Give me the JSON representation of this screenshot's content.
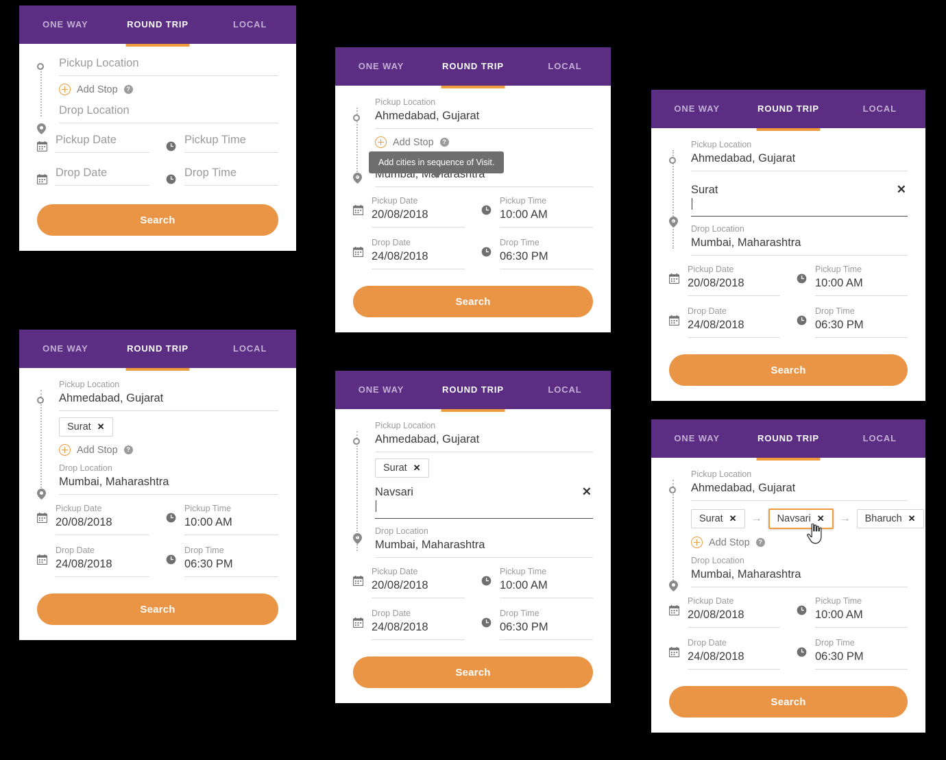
{
  "theme": {
    "purple": "#5B2E83",
    "orange": "#EA9445",
    "tooltip_gray": "#6E6E6E",
    "background": "#000000"
  },
  "tabs": {
    "one_way": "ONE WAY",
    "round_trip": "ROUND TRIP",
    "local": "LOCAL",
    "active": "ROUND TRIP"
  },
  "labels": {
    "pickup_location": "Pickup Location",
    "drop_location": "Drop Location",
    "pickup_date": "Pickup Date",
    "drop_date": "Drop Date",
    "pickup_time": "Pickup Time",
    "drop_time": "Drop Time",
    "add_stop": "Add Stop",
    "search": "Search",
    "help_glyph": "?",
    "clear_glyph": "✕",
    "chip_remove_glyph": "✕",
    "arrow_glyph": "→"
  },
  "tooltip": {
    "text": "Add cities in sequence of Visit."
  },
  "values": {
    "pickup_location": "Ahmedabad, Gujarat",
    "drop_location": "Mumbai, Maharashtra",
    "pickup_date": "20/08/2018",
    "drop_date": "24/08/2018",
    "pickup_time": "10:00 AM",
    "drop_time": "06:30 PM"
  },
  "cards": [
    {
      "id": "card1",
      "state": "empty-form",
      "pickup_value": "",
      "pickup_placeholder": "Pickup Location",
      "drop_value": "",
      "drop_placeholder": "Drop Location",
      "pickup_date": "",
      "pickup_date_placeholder": "Pickup Date",
      "drop_date": "",
      "drop_date_placeholder": "Drop Date",
      "pickup_time": "",
      "pickup_time_placeholder": "Pickup Time",
      "drop_time": "",
      "drop_time_placeholder": "Drop Time",
      "stops": [],
      "typing_value": null,
      "tooltip_visible": false,
      "cursor_visible": false
    },
    {
      "id": "card2",
      "state": "tooltip-on-add-stop",
      "pickup_value": "Ahmedabad, Gujarat",
      "drop_value": "Mumbai, Maharashtra",
      "pickup_date": "20/08/2018",
      "drop_date": "24/08/2018",
      "pickup_time": "10:00 AM",
      "drop_time": "06:30 PM",
      "stops": [],
      "typing_value": null,
      "tooltip_visible": true,
      "tooltip_text": "Add cities in sequence of Visit.",
      "cursor_visible": false
    },
    {
      "id": "card3",
      "state": "typing-first-stop",
      "pickup_value": "Ahmedabad, Gujarat",
      "drop_value": "Mumbai, Maharashtra",
      "pickup_date": "20/08/2018",
      "drop_date": "24/08/2018",
      "pickup_time": "10:00 AM",
      "drop_time": "06:30 PM",
      "stops": [],
      "typing_value": "Surat",
      "tooltip_visible": false,
      "cursor_visible": false
    },
    {
      "id": "card4",
      "state": "one-stop-chip",
      "pickup_value": "Ahmedabad, Gujarat",
      "drop_value": "Mumbai, Maharashtra",
      "pickup_date": "20/08/2018",
      "drop_date": "24/08/2018",
      "pickup_time": "10:00 AM",
      "drop_time": "06:30 PM",
      "stops": [
        {
          "label": "Surat",
          "dragging": false
        }
      ],
      "typing_value": null,
      "tooltip_visible": false,
      "cursor_visible": false
    },
    {
      "id": "card5",
      "state": "typing-second-stop",
      "pickup_value": "Ahmedabad, Gujarat",
      "drop_value": "Mumbai, Maharashtra",
      "pickup_date": "20/08/2018",
      "drop_date": "24/08/2018",
      "pickup_time": "10:00 AM",
      "drop_time": "06:30 PM",
      "stops": [
        {
          "label": "Surat",
          "dragging": false
        }
      ],
      "typing_value": "Navsari",
      "tooltip_visible": false,
      "cursor_visible": false
    },
    {
      "id": "card6",
      "state": "three-stops-reorder",
      "pickup_value": "Ahmedabad, Gujarat",
      "drop_value": "Mumbai, Maharashtra",
      "pickup_date": "20/08/2018",
      "drop_date": "24/08/2018",
      "pickup_time": "10:00 AM",
      "drop_time": "06:30 PM",
      "stops": [
        {
          "label": "Surat",
          "dragging": false
        },
        {
          "label": "Navsari",
          "dragging": true
        },
        {
          "label": "Bharuch",
          "dragging": false
        }
      ],
      "typing_value": null,
      "tooltip_visible": false,
      "cursor_visible": true
    }
  ]
}
